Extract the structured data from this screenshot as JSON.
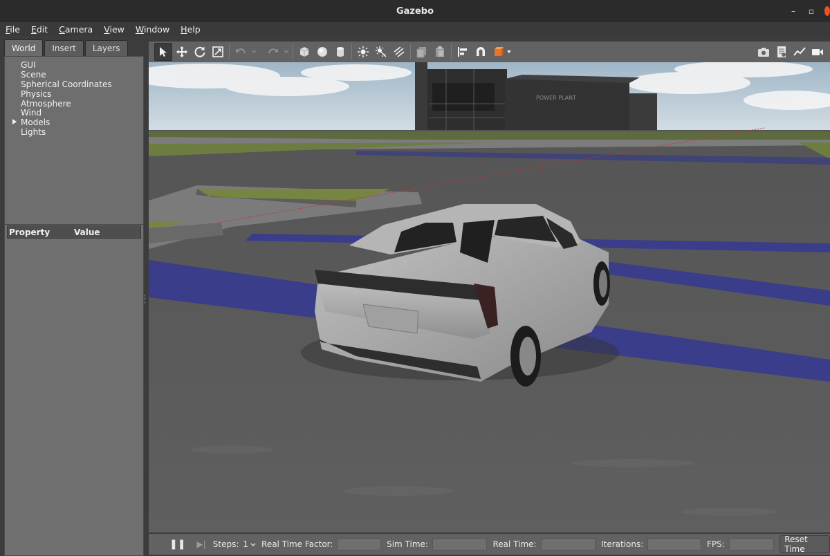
{
  "window": {
    "title": "Gazebo",
    "minimize_glyph": "–",
    "maximize_glyph": "▫"
  },
  "menu": [
    {
      "label": "File",
      "mnemonic": "F",
      "rest": "ile"
    },
    {
      "label": "Edit",
      "mnemonic": "E",
      "rest": "dit"
    },
    {
      "label": "Camera",
      "mnemonic": "C",
      "rest": "amera"
    },
    {
      "label": "View",
      "mnemonic": "V",
      "rest": "iew"
    },
    {
      "label": "Window",
      "mnemonic": "W",
      "rest": "indow"
    },
    {
      "label": "Help",
      "mnemonic": "H",
      "rest": "elp"
    }
  ],
  "left_panel": {
    "tabs": [
      "World",
      "Insert",
      "Layers"
    ],
    "active_tab": "World",
    "tree": [
      "GUI",
      "Scene",
      "Spherical Coordinates",
      "Physics",
      "Atmosphere",
      "Wind",
      "Models",
      "Lights"
    ],
    "expandable": "Models",
    "property_header": {
      "property": "Property",
      "value": "Value"
    }
  },
  "toolbar": {
    "left_icons": [
      "select-arrow-icon",
      "translate-icon",
      "rotate-icon",
      "scale-icon",
      "undo-icon",
      "redo-icon",
      "box-icon",
      "sphere-icon",
      "cylinder-icon",
      "point-light-icon",
      "spot-light-icon",
      "directional-light-icon",
      "copy-icon",
      "paste-icon",
      "align-icon",
      "snap-icon",
      "view-angle-icon"
    ],
    "right_icons": [
      "screenshot-icon",
      "log-icon",
      "plot-icon",
      "record-video-icon"
    ]
  },
  "viewport": {
    "scene": "3D render of a white hatchback car on an asphalt road with blue lane markings, a grass median, and a power plant building under a cloudy sky",
    "building_sign": "POWER PLANT"
  },
  "bottom_bar": {
    "pause_glyph": "❚❚",
    "step_glyph": "▶|",
    "steps_label": "Steps:",
    "steps_value": "1",
    "rtf_label": "Real Time Factor:",
    "sim_time_label": "Sim Time:",
    "real_time_label": "Real Time:",
    "iterations_label": "Iterations:",
    "fps_label": "FPS:",
    "reset_button": "Reset Time"
  },
  "colors": {
    "accent_close": "#e95420",
    "panel_bg": "#6e6e6e",
    "toolbar_bg": "#626262",
    "lane_blue": "#3a3d8a"
  }
}
